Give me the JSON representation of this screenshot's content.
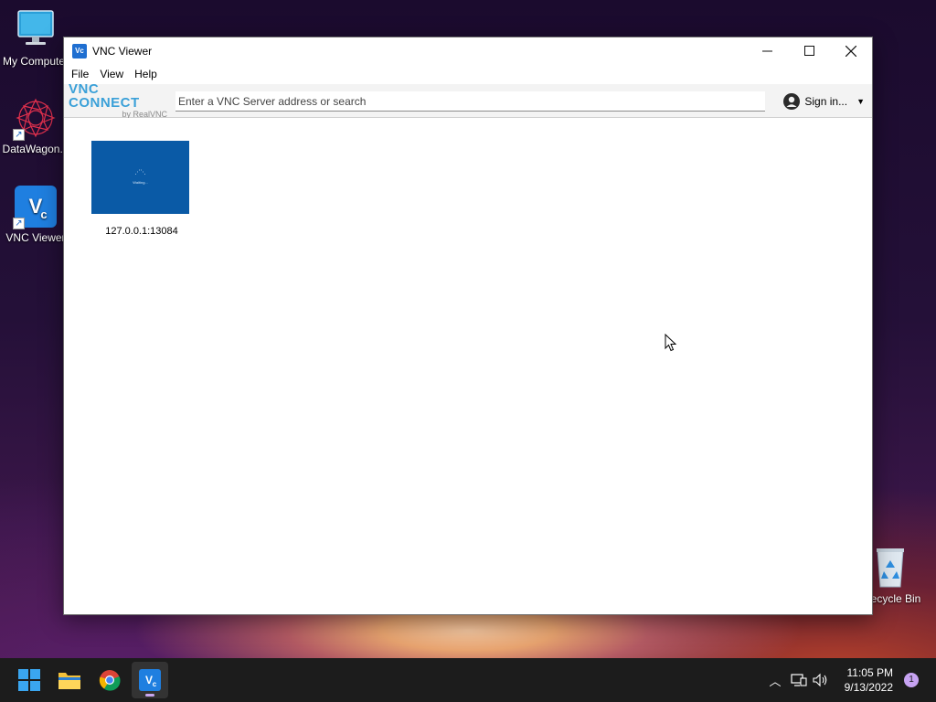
{
  "desktop": {
    "icons": [
      {
        "label": "My Computer"
      },
      {
        "label": "DataWagon..."
      },
      {
        "label": "VNC Viewer"
      },
      {
        "label": "Recycle Bin"
      }
    ]
  },
  "window": {
    "title": "VNC Viewer",
    "menu": [
      "File",
      "View",
      "Help"
    ],
    "brand": {
      "main": "VNC CONNECT",
      "sub": "by RealVNC"
    },
    "search": {
      "placeholder": "Enter a VNC Server address or search",
      "value": ""
    },
    "signin_label": "Sign in...",
    "connections": [
      {
        "label": "127.0.0.1:13084",
        "preview_text": "Waiting..."
      }
    ]
  },
  "taskbar": {
    "time": "11:05 PM",
    "date": "9/13/2022",
    "notification_count": "1"
  },
  "colors": {
    "accent": "#1f6fd1",
    "thumbnail_bg": "#0a5aa6",
    "taskbar_bg": "#1c1c1c"
  }
}
